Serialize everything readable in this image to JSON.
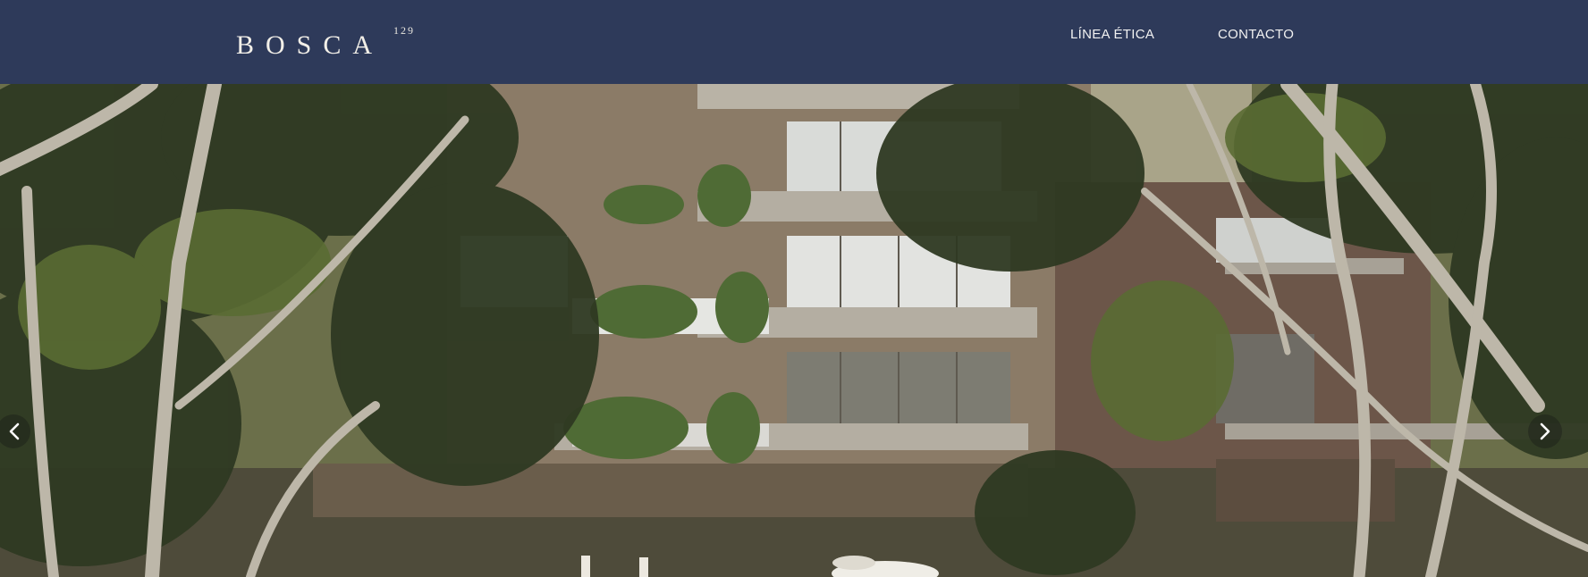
{
  "header": {
    "logo_text": "BOSCA",
    "logo_superscript": "129",
    "nav": [
      {
        "label": "LÍNEA ÉTICA"
      },
      {
        "label": "CONTACTO"
      }
    ]
  },
  "hero": {
    "image": "building-with-trees-render",
    "carousel": {
      "prev_icon": "chevron-left-icon",
      "next_icon": "chevron-right-icon"
    }
  },
  "colors": {
    "header_bg": "#2e3a5a",
    "header_text": "#f1f1f1"
  }
}
